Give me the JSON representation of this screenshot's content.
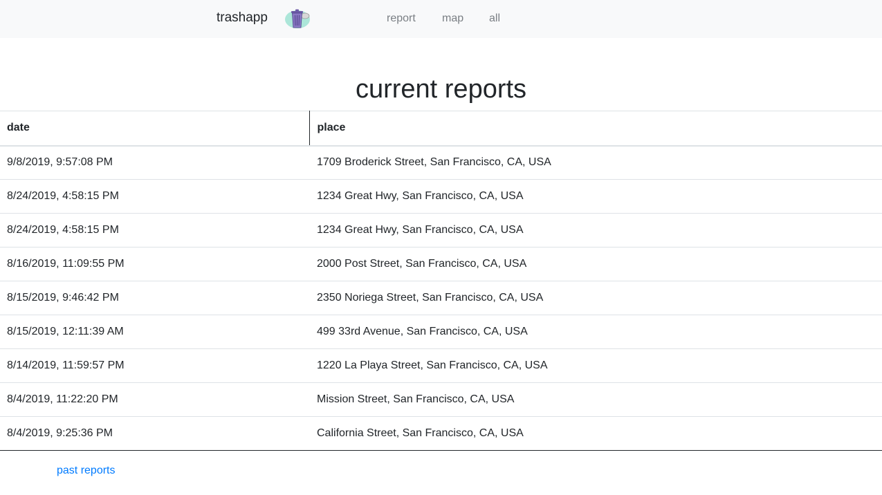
{
  "nav": {
    "brand": "trashapp",
    "logo_icon": "trash-can-logo-icon",
    "links": [
      "report",
      "map",
      "all"
    ]
  },
  "page": {
    "title": "current reports"
  },
  "table": {
    "headers": {
      "date": "date",
      "place": "place"
    },
    "rows": [
      {
        "date": "9/8/2019, 9:57:08 PM",
        "place": "1709 Broderick Street, San Francisco, CA, USA"
      },
      {
        "date": "8/24/2019, 4:58:15 PM",
        "place": "1234 Great Hwy, San Francisco, CA, USA"
      },
      {
        "date": "8/24/2019, 4:58:15 PM",
        "place": "1234 Great Hwy, San Francisco, CA, USA"
      },
      {
        "date": "8/16/2019, 11:09:55 PM",
        "place": "2000 Post Street, San Francisco, CA, USA"
      },
      {
        "date": "8/15/2019, 9:46:42 PM",
        "place": "2350 Noriega Street, San Francisco, CA, USA"
      },
      {
        "date": "8/15/2019, 12:11:39 AM",
        "place": "499 33rd Avenue, San Francisco, CA, USA"
      },
      {
        "date": "8/14/2019, 11:59:57 PM",
        "place": "1220 La Playa Street, San Francisco, CA, USA"
      },
      {
        "date": "8/4/2019, 11:22:20 PM",
        "place": "Mission Street, San Francisco, CA, USA"
      },
      {
        "date": "8/4/2019, 9:25:36 PM",
        "place": "California Street, San Francisco, CA, USA"
      }
    ]
  },
  "footer": {
    "past_reports_label": "past reports"
  },
  "colors": {
    "navbar_bg": "#f8f9fa",
    "link": "#007bff",
    "nav_link": "#7a7f84"
  }
}
